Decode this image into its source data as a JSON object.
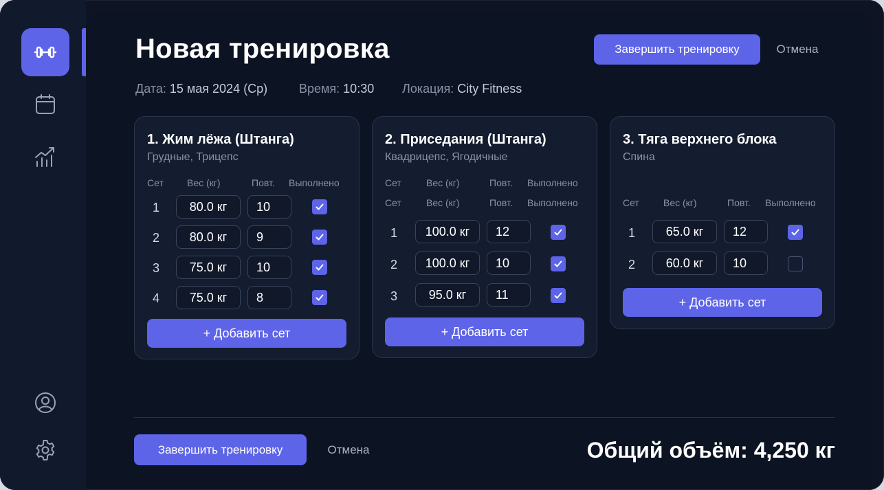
{
  "sidebar": {
    "items": [
      {
        "icon": "dumbbell-icon",
        "active": true
      },
      {
        "icon": "calendar-icon",
        "active": false
      },
      {
        "icon": "stats-chart-icon",
        "active": false
      },
      {
        "icon": "profile-icon",
        "active": false
      },
      {
        "icon": "gear-icon",
        "active": false
      }
    ]
  },
  "header": {
    "title": "Новая тренировка",
    "finish_label": "Завершить тренировку",
    "cancel_label": "Отмена"
  },
  "meta": {
    "date_label": "Дата:",
    "date_value": "15 мая 2024 (Ср)",
    "time_label": "Время:",
    "time_value": "10:30",
    "location_label": "Локация:",
    "location_value": "City Fitness"
  },
  "columns": {
    "set": "Сет",
    "weight": "Вес (кг)",
    "reps": "Повт.",
    "done": "Выполнено"
  },
  "exercises": [
    {
      "title": "1. Жим лёжа (Штанга)",
      "muscles": "Грудные, Трицепс",
      "sets": [
        {
          "n": "1",
          "weight": "80.0 кг",
          "reps": "10",
          "done": true
        },
        {
          "n": "2",
          "weight": "80.0 кг",
          "reps": "9",
          "done": true
        },
        {
          "n": "3",
          "weight": "75.0 кг",
          "reps": "10",
          "done": true
        },
        {
          "n": "4",
          "weight": "75.0 кг",
          "reps": "8",
          "done": true
        }
      ],
      "add_label": "+ Добавить сет"
    },
    {
      "title": "2. Приседания (Штанга)",
      "muscles": "Квадрицепс, Ягодичные",
      "sets": [
        {
          "n": "1",
          "weight": "100.0 кг",
          "reps": "12",
          "done": true
        },
        {
          "n": "2",
          "weight": "100.0 кг",
          "reps": "10",
          "done": true
        },
        {
          "n": "3",
          "weight": "95.0 кг",
          "reps": "11",
          "done": true
        }
      ],
      "add_label": "+ Добавить сет"
    },
    {
      "title": "3. Тяга верхнего блока",
      "muscles": "Спина",
      "sets": [
        {
          "n": "1",
          "weight": "65.0 кг",
          "reps": "12",
          "done": true
        },
        {
          "n": "2",
          "weight": "60.0 кг",
          "reps": "10",
          "done": false
        }
      ],
      "add_label": "+ Добавить сет"
    }
  ],
  "footer": {
    "finish_label": "Завершить тренировку",
    "cancel_label": "Отмена",
    "total_label": "Общий объём:",
    "total_value": "4,250 кг"
  },
  "colors": {
    "accent": "#5d64e8",
    "background": "#0c1322",
    "card": "#141c2f"
  }
}
